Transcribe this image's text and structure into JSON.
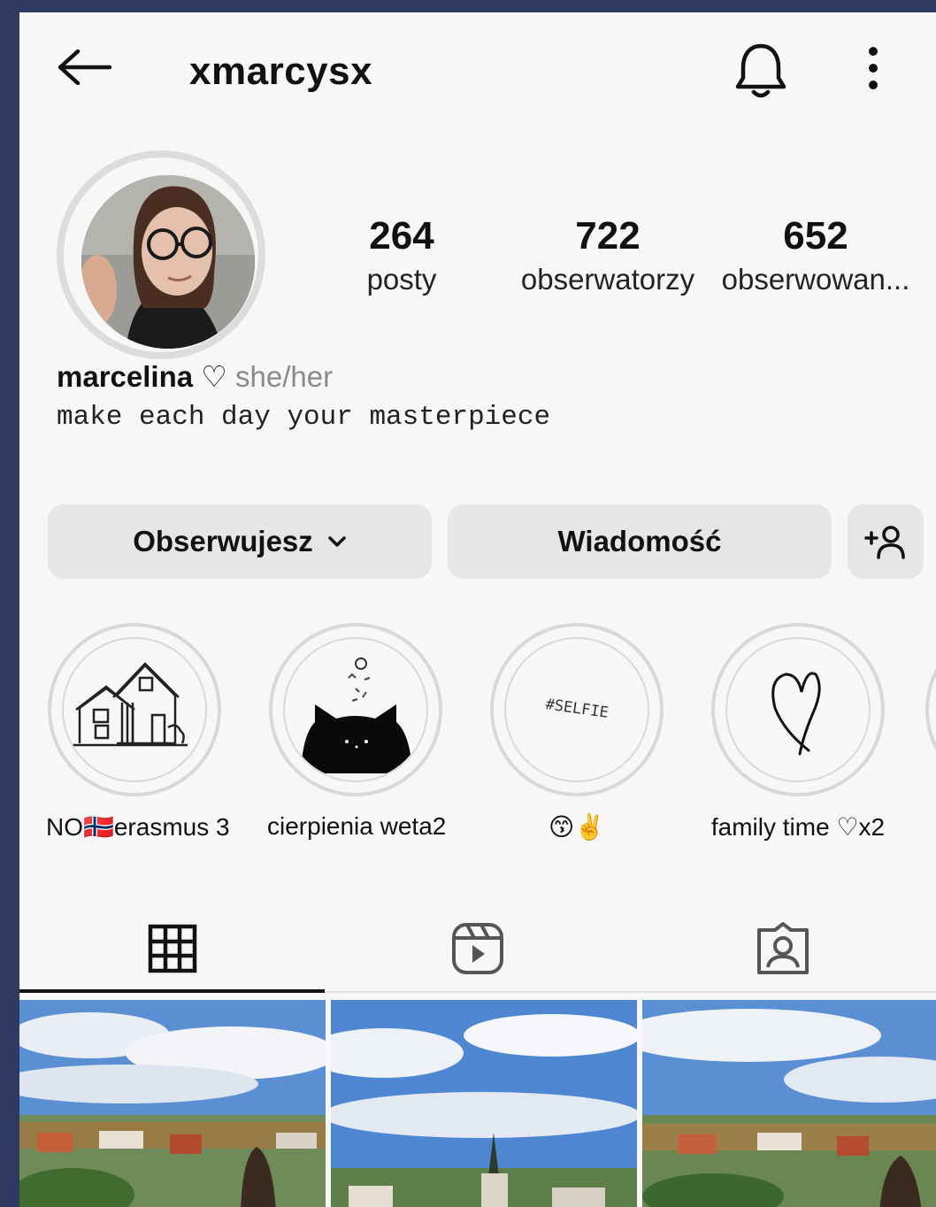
{
  "header": {
    "username": "xmarcysx",
    "back_icon": "arrow-left-icon",
    "bell_icon": "bell-icon",
    "more_icon": "more-vertical-icon"
  },
  "stats": [
    {
      "value": "264",
      "label": "posty"
    },
    {
      "value": "722",
      "label": "obserwatorzy"
    },
    {
      "value": "652",
      "label": "obserwowan..."
    }
  ],
  "profile": {
    "name": "marcelina ♡",
    "pronouns": "she/her",
    "bio": "make each day your masterpiece"
  },
  "buttons": {
    "follow": "Obserwujesz",
    "message": "Wiadomość",
    "add_user_icon": "add-user-icon"
  },
  "highlights": [
    {
      "label": "NO🇳🇴erasmus 3"
    },
    {
      "label": "cierpienia weta2"
    },
    {
      "label": "😙✌️",
      "cover_text": "#SELFIE"
    },
    {
      "label": "family time ♡x2"
    }
  ],
  "tabs": [
    {
      "icon": "grid-icon",
      "selected": true
    },
    {
      "icon": "reels-icon",
      "selected": false
    },
    {
      "icon": "tagged-icon",
      "selected": false
    }
  ],
  "colors": {
    "background": "#2f3a62",
    "screen": "#f7f7f7",
    "button": "#e6e6e6",
    "text": "#111111",
    "muted": "#8a8a8a"
  }
}
